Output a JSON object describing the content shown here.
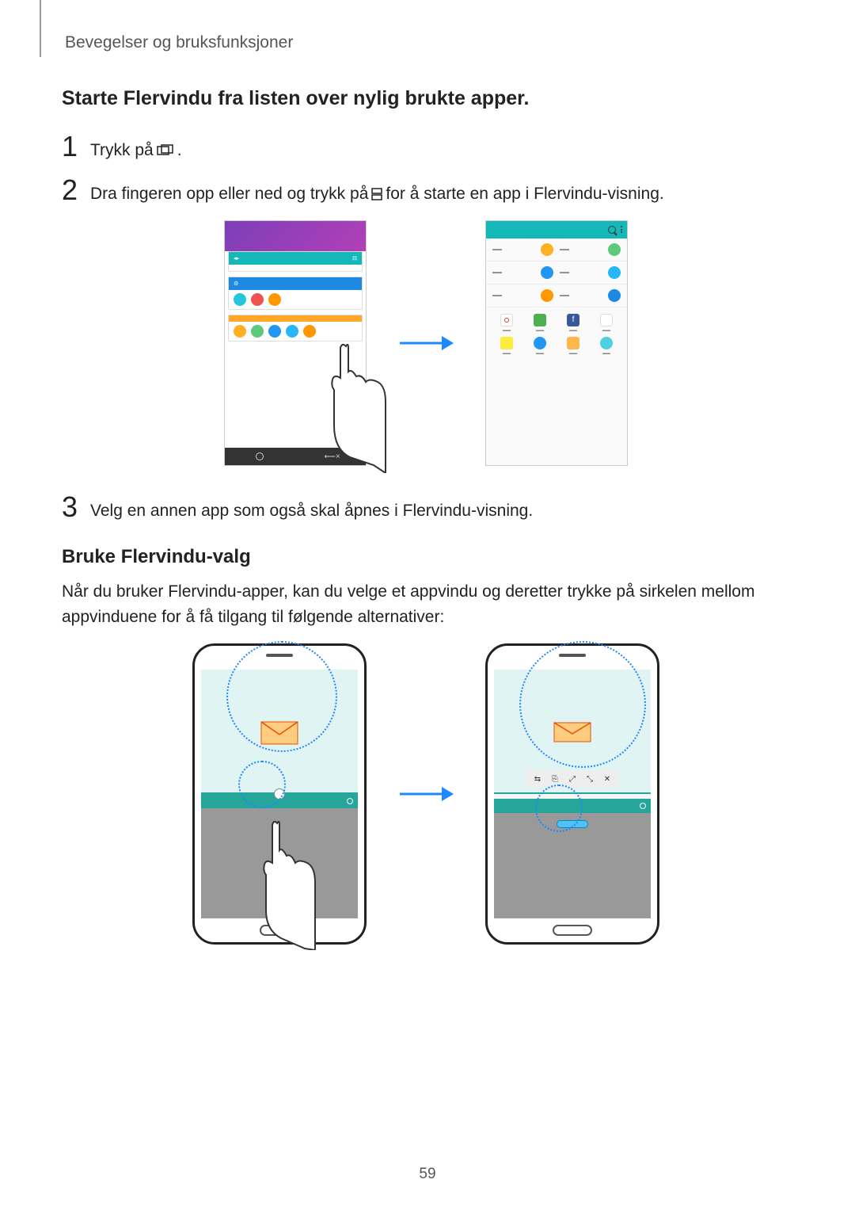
{
  "header": "Bevegelser og bruksfunksjoner",
  "section1": {
    "title": "Starte Flervindu fra listen over nylig brukte apper.",
    "steps": {
      "s1": {
        "num": "1",
        "pre": "Trykk på ",
        "post": "."
      },
      "s2": {
        "num": "2",
        "pre": "Dra fingeren opp eller ned og trykk på ",
        "post": " for å starte en app i Flervindu-visning."
      },
      "s3": {
        "num": "3",
        "text": "Velg en annen app som også skal åpnes i Flervindu-visning."
      }
    }
  },
  "section2": {
    "title": "Bruke Flervindu-valg",
    "body": "Når du bruker Flervindu-apper, kan du velge et appvindu og deretter trykke på sirkelen mellom appvinduene for å få tilgang til følgende alternativer:"
  },
  "page_number": "59"
}
